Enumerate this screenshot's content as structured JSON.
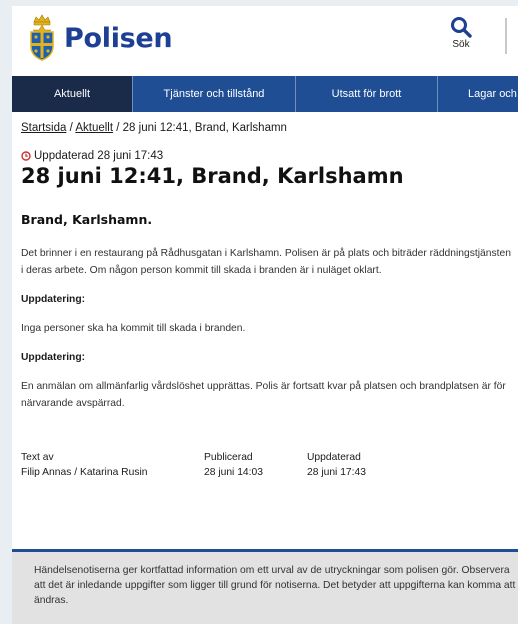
{
  "site": {
    "brand": "Polisen"
  },
  "header": {
    "search_label": "Sök"
  },
  "nav": {
    "items": [
      {
        "label": "Aktuellt",
        "active": true
      },
      {
        "label": "Tjänster och tillstånd",
        "active": false
      },
      {
        "label": "Utsatt för brott",
        "active": false
      },
      {
        "label": "Lagar och",
        "active": false
      }
    ]
  },
  "breadcrumb": {
    "startsida": "Startsida",
    "sep1": " / ",
    "aktuellt": "Aktuellt",
    "current": " / 28 juni 12:41, Brand, Karlshamn"
  },
  "article": {
    "updated": "Uppdaterad 28 juni 17:43",
    "title": "28 juni 12:41, Brand, Karlshamn",
    "lead": "Brand, Karlshamn.",
    "paragraph1": "Det brinner i en restaurang på Rådhusgatan i Karlshamn. Polisen är på plats och biträder räddningstjänsten i deras arbete. Om någon person kommit till skada i branden är i nuläget oklart.",
    "update_heading_1": "Uppdatering:",
    "paragraph2": "Inga personer ska ha kommit till skada i branden.",
    "update_heading_2": "Uppdatering:",
    "paragraph3": "En anmälan om allmänfarlig vårdslöshet upprättas. Polis är fortsatt kvar på platsen och brandplatsen är för närvarande avspärrad."
  },
  "meta": {
    "text_by_label": "Text av",
    "text_by_value": "Filip Annas / Katarina Rusin",
    "published_label": "Publicerad",
    "published_value": "28 juni 14:03",
    "updated_label": "Uppdaterad",
    "updated_value": "28 juni 17:43"
  },
  "notice": {
    "text": "Händelsenotiserna ger kortfattad information om ett urval av de utryckningar som polisen gör. Observera att det är inledande uppgifter som ligger till grund för notiserna. Det betyder att uppgifterna kan komma att ändras."
  },
  "colors": {
    "brand_blue": "#1d3f94",
    "nav_blue": "#1f4e95",
    "nav_active": "#1a2a49",
    "alert_red": "#d0302f"
  },
  "icons": {
    "search": "search-icon",
    "clock": "clock-icon",
    "crest": "police-crest-logo"
  }
}
